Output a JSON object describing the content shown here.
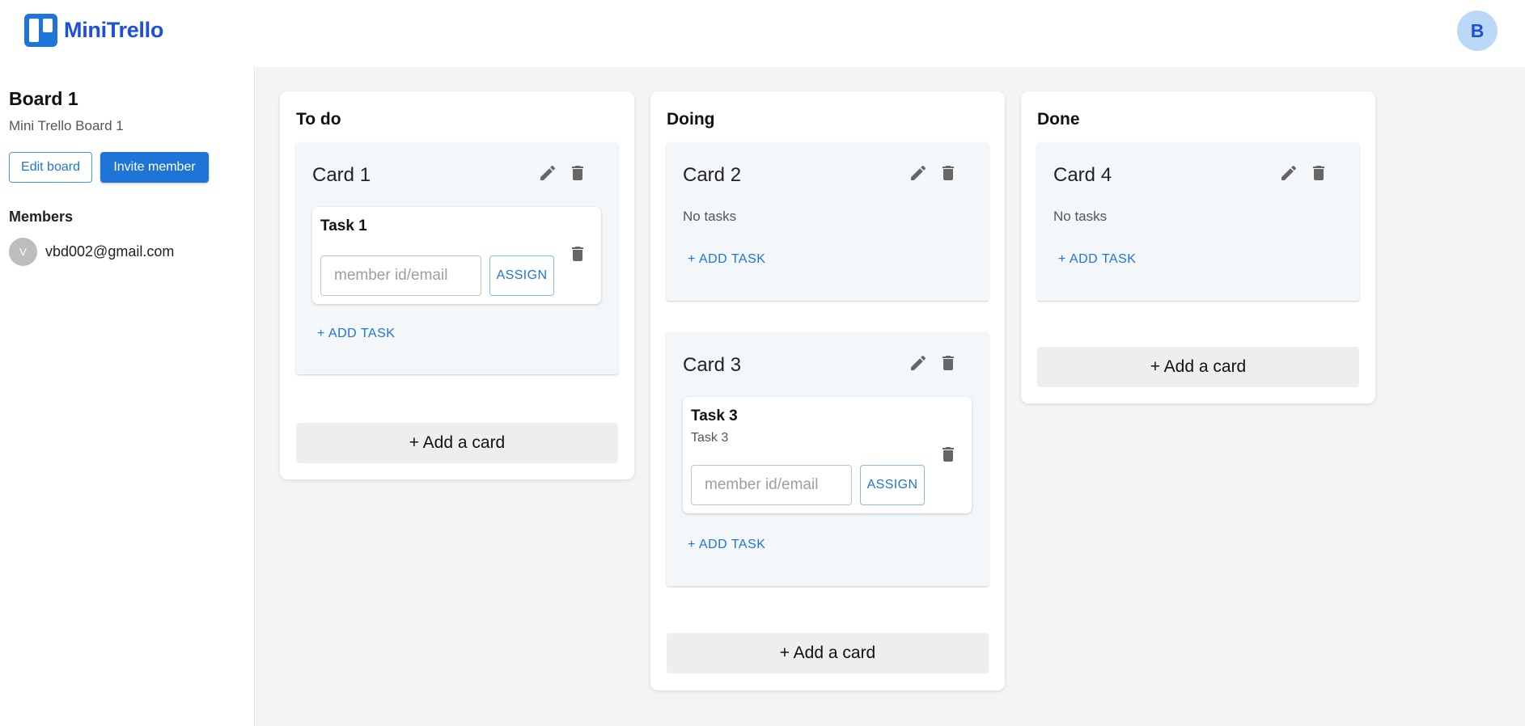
{
  "app": {
    "name": "MiniTrello",
    "user_initial": "B"
  },
  "sidebar": {
    "board_title": "Board 1",
    "board_description": "Mini Trello Board 1",
    "edit_label": "Edit board",
    "invite_label": "Invite member",
    "members_title": "Members",
    "members": [
      {
        "initial": "V",
        "email": "vbd002@gmail.com"
      }
    ]
  },
  "columns": [
    {
      "title": "To do",
      "cards": [
        {
          "title": "Card 1",
          "tasks": [
            {
              "title": "Task 1",
              "description": "",
              "input_placeholder": "member id/email",
              "assign_label": "ASSIGN"
            }
          ],
          "add_task_label": "+ ADD TASK"
        }
      ],
      "add_card_label": "+ Add a card"
    },
    {
      "title": "Doing",
      "cards": [
        {
          "title": "Card 2",
          "no_tasks_label": "No tasks",
          "add_task_label": "+ ADD TASK"
        },
        {
          "title": "Card 3",
          "tasks": [
            {
              "title": "Task 3",
              "description": "Task 3",
              "input_placeholder": "member id/email",
              "assign_label": "ASSIGN"
            }
          ],
          "add_task_label": "+ ADD TASK"
        }
      ],
      "add_card_label": "+ Add a card"
    },
    {
      "title": "Done",
      "cards": [
        {
          "title": "Card 4",
          "no_tasks_label": "No tasks",
          "add_task_label": "+ ADD TASK"
        }
      ],
      "add_card_label": "+ Add a card"
    }
  ],
  "colors": {
    "primary": "#1f74d8",
    "logo_text": "#1d4fd8",
    "board_bg": "#f3f4f6",
    "card_bg": "#f4f7fa",
    "avatar_bg": "#bcd8f8"
  },
  "icons": {
    "edit": "pencil-icon",
    "delete": "trash-icon",
    "logo": "trello-logo-icon"
  }
}
